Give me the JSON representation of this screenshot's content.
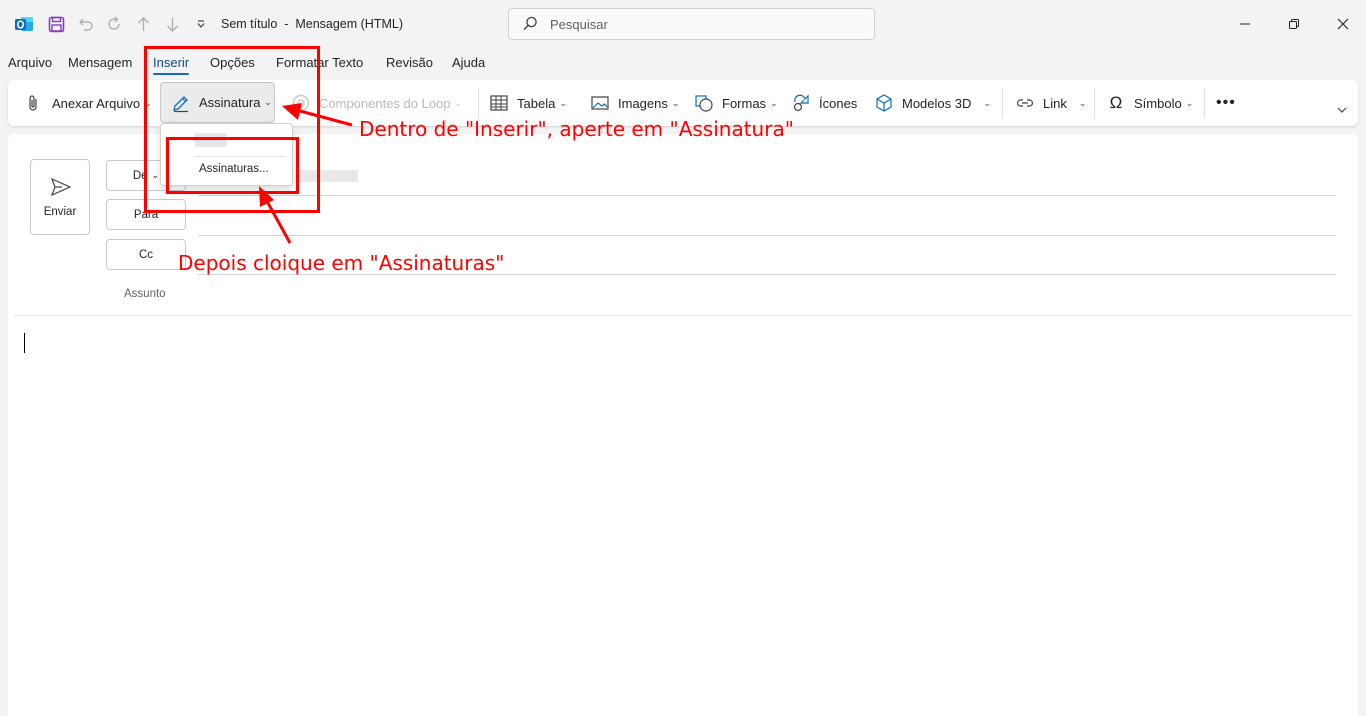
{
  "window": {
    "title": "Sem título  -  Mensagem (HTML)",
    "search_placeholder": "Pesquisar"
  },
  "tabs": [
    "Arquivo",
    "Mensagem",
    "Inserir",
    "Opções",
    "Formatar Texto",
    "Revisão",
    "Ajuda"
  ],
  "active_tab": "Inserir",
  "ribbon": {
    "attach": "Anexar Arquivo",
    "signature": "Assinatura",
    "loop": "Componentes do Loop",
    "table": "Tabela",
    "images": "Imagens",
    "shapes": "Formas",
    "icons": "Ícones",
    "models3d": "Modelos 3D",
    "link": "Link",
    "symbol": "Símbolo"
  },
  "signature_menu": {
    "item": "Assinaturas..."
  },
  "compose": {
    "send": "Enviar",
    "from": "De",
    "to": "Para",
    "cc": "Cc",
    "subject": "Assunto"
  },
  "annotations": {
    "step1": "Dentro de \"Inserir\", aperte em \"Assinatura\"",
    "step2": "Depois cloique em \"Assinaturas\""
  },
  "colors": {
    "accent": "#0f6cbd",
    "annotation": "#ff0000",
    "outlook_blue": "#0f6cbd",
    "save_purple": "#8a3ab9"
  }
}
